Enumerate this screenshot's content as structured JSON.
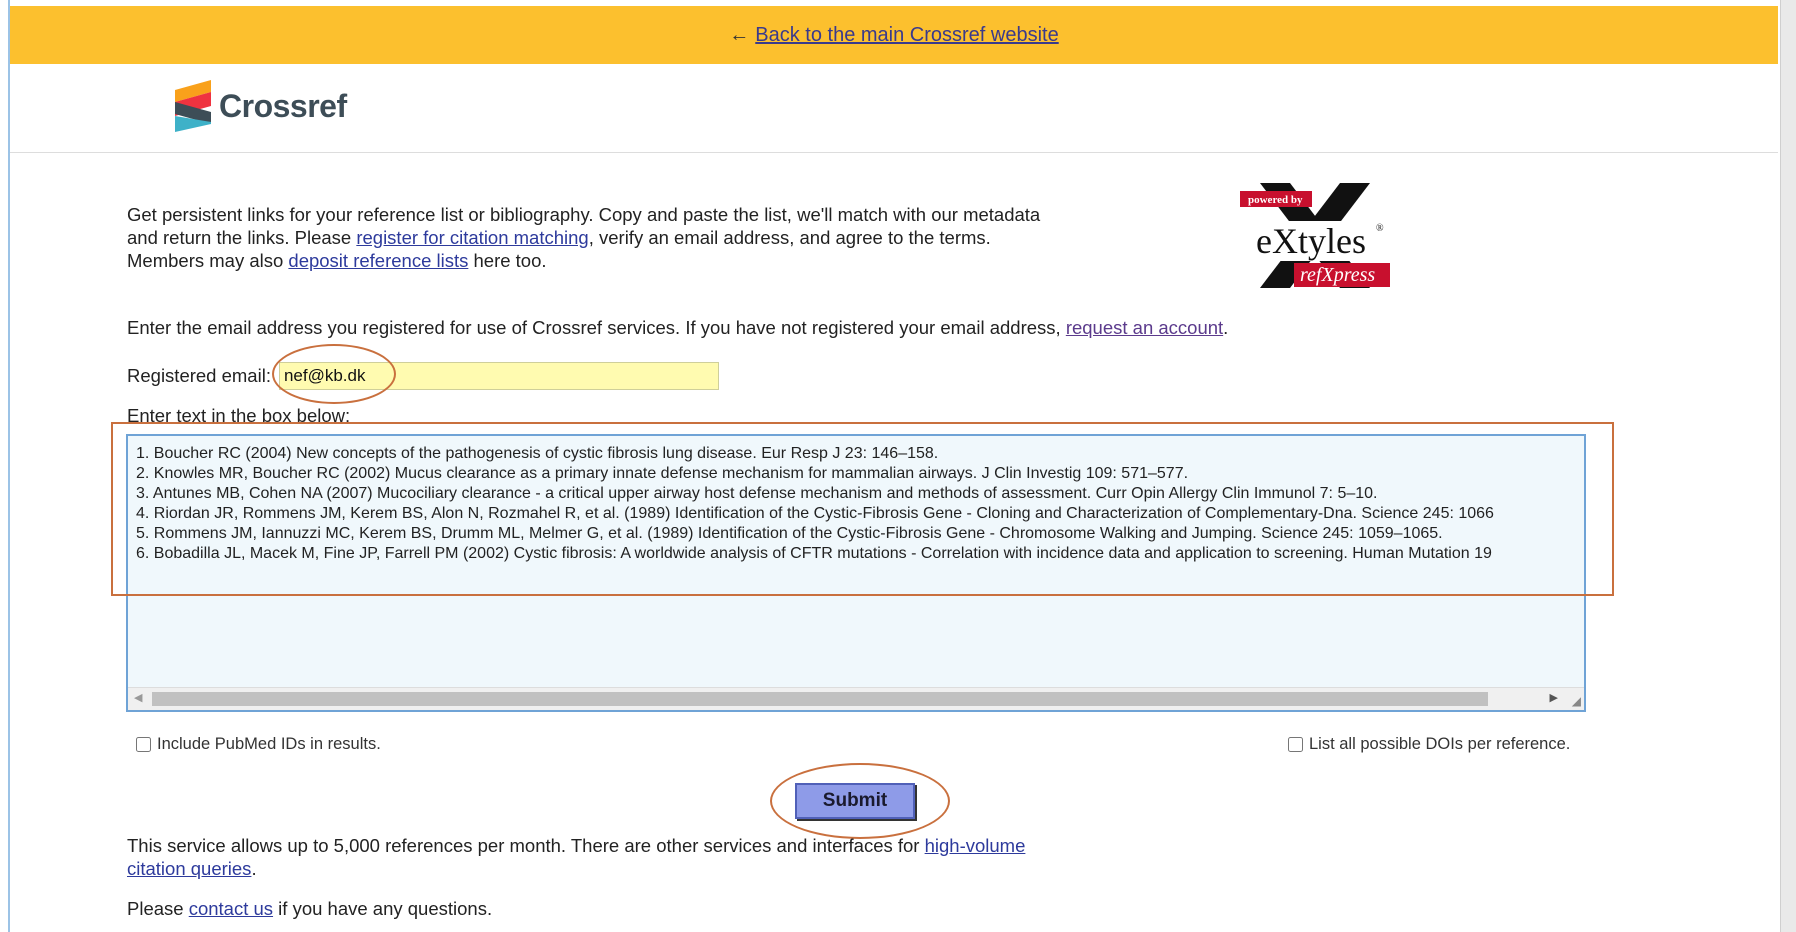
{
  "topbar": {
    "arrow": "←",
    "back_link": "Back to the main Crossref website",
    "bg_color": "#fcc02e"
  },
  "header": {
    "logo_text": "Crossref",
    "logo_icon": "crossref-logo-icon"
  },
  "intro": {
    "text_1": "Get persistent links for your reference list or bibliography. Copy and paste the list, we'll match with our metadata and return the links. Please ",
    "link_register": "register for citation matching",
    "text_2": ", verify an email address, and agree to the terms. Members may also ",
    "link_deposit": "deposit reference lists",
    "text_3": " here too."
  },
  "extyles_logo": {
    "powered_by": "powered by",
    "brand": "eXtyles",
    "sub": "refXpress",
    "reg": "®"
  },
  "account": {
    "text": "Enter the email address you registered for use of Crossref services. If you have not registered your email address, ",
    "link": "request an account",
    "suffix": "."
  },
  "email": {
    "label": "Registered email:",
    "value": "nef@kb.dk"
  },
  "textarea": {
    "label": "Enter text in the box below:",
    "lines": [
      "1. Boucher RC (2004) New concepts of the pathogenesis of cystic fibrosis lung disease. Eur Resp J 23: 146–158.",
      "2. Knowles MR, Boucher RC (2002) Mucus clearance as a primary innate defense mechanism for mammalian airways. J Clin Investig 109: 571–577.",
      "3. Antunes MB, Cohen NA (2007) Mucociliary clearance - a critical upper airway host defense mechanism and methods of assessment. Curr Opin Allergy Clin Immunol 7: 5–10.",
      "4. Riordan JR, Rommens JM, Kerem BS, Alon N, Rozmahel R, et al. (1989) Identification of the Cystic-Fibrosis Gene - Cloning and Characterization of Complementary-Dna. Science 245: 1066",
      "5. Rommens JM, Iannuzzi MC, Kerem BS, Drumm ML, Melmer G, et al. (1989) Identification of the Cystic-Fibrosis Gene - Chromosome Walking and Jumping. Science 245: 1059–1065.",
      "6. Bobadilla JL, Macek M, Fine JP, Farrell PM (2002) Cystic fibrosis: A worldwide analysis of CFTR mutations - Correlation with incidence data and application to screening. Human Mutation 19"
    ]
  },
  "options": {
    "pubmed_label": "Include PubMed IDs in results.",
    "pubmed_checked": false,
    "all_dois_label": "List all possible DOIs per reference.",
    "all_dois_checked": false
  },
  "submit_label": "Submit",
  "service": {
    "text": "This service allows up to 5,000 references per month. There are other services and interfaces for ",
    "link": "high-volume citation queries",
    "suffix": "."
  },
  "contact": {
    "prefix": "Please ",
    "link": "contact us",
    "suffix": " if you have any questions."
  },
  "annotation_color": "#c9703e"
}
